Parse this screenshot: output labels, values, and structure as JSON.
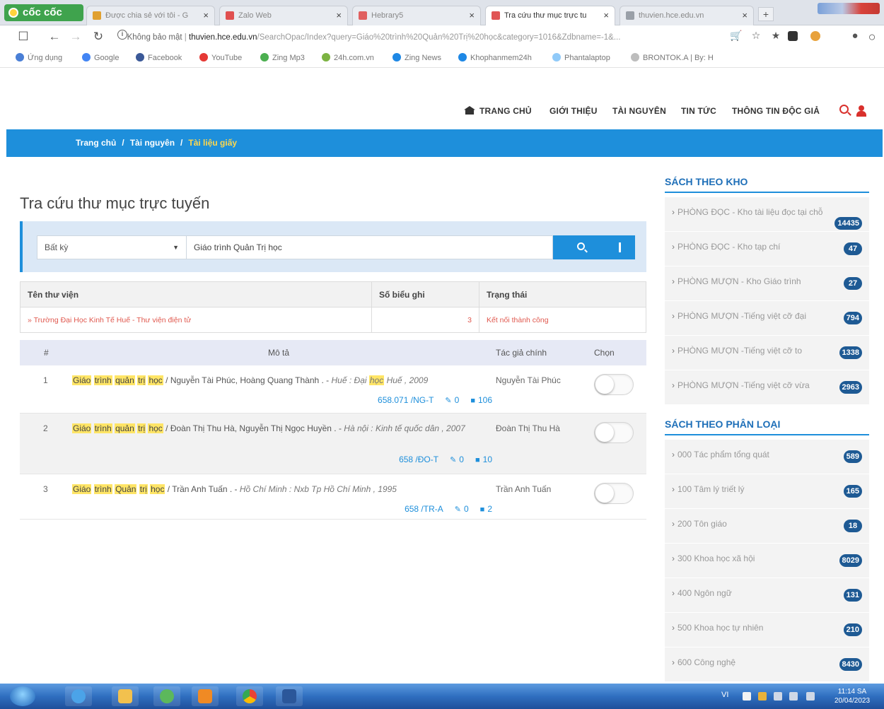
{
  "browser": {
    "brand": "cốc cốc",
    "tabs": [
      {
        "title": "Được chia sẻ với tôi - G",
        "color": "#e0a030"
      },
      {
        "title": "Zalo Web",
        "color": "#e05050"
      },
      {
        "title": "Hebrary5",
        "color": "#e06060"
      },
      {
        "title": "Tra cứu thư mục trực tu",
        "color": "#e05555"
      },
      {
        "title": "thuvien.hce.edu.vn",
        "color": "#9aa0a8"
      }
    ],
    "new_tab": "+",
    "address": {
      "not_secure": "Không bảo mật",
      "host": "thuvien.hce.edu.vn",
      "path": "/SearchOpac/Index?query=Giáo%20trình%20Quản%20Trị%20học&category=1016&Zdbname=-1&..."
    },
    "bookmarks": [
      {
        "label": "Ứng dụng",
        "color": "#4a7fd6"
      },
      {
        "label": "Google",
        "color": "#4285f4"
      },
      {
        "label": "Facebook",
        "color": "#3b5998"
      },
      {
        "label": "YouTube",
        "color": "#e53935"
      },
      {
        "label": "Zing Mp3",
        "color": "#4caf50"
      },
      {
        "label": "24h.com.vn",
        "color": "#7cb342"
      },
      {
        "label": "Zing News",
        "color": "#1e88e5"
      },
      {
        "label": "Khophanmem24h",
        "color": "#1e88e5"
      },
      {
        "label": "Phantalaptop",
        "color": "#90caf9"
      },
      {
        "label": "BRONTOK.A | By: H",
        "color": "#bdbdbd"
      }
    ]
  },
  "site": {
    "nav": [
      "TRANG CHỦ",
      "GIỚI THIỆU",
      "TÀI NGUYÊN",
      "TIN TỨC",
      "THÔNG TIN ĐỘC GIẢ"
    ],
    "breadcrumb": [
      "Trang chủ",
      "Tài nguyên",
      "Tài liệu giấy"
    ]
  },
  "main": {
    "title": "Tra cứu thư mục trực tuyến",
    "search": {
      "field": "Bất kỳ",
      "query": "Giáo trình Quản Trị học"
    },
    "library_table": {
      "headers": [
        "Tên thư viện",
        "Số biểu ghi",
        "Trạng thái"
      ],
      "rows": [
        {
          "name": "» Trường Đại Học Kinh Tế Huế - Thư viện điện tử",
          "count": "3",
          "status": "Kết nối thành công"
        }
      ]
    },
    "results": {
      "headers": [
        "#",
        "Mô tả",
        "Tác giả chính",
        "Chọn"
      ],
      "rows": [
        {
          "idx": "1",
          "title_words": [
            "Giáo",
            "trình",
            "quản",
            "trị",
            "học"
          ],
          "rest": " / Nguyễn Tài Phúc, Hoàng Quang Thành . - ",
          "pub_a": "Huế : Đại ",
          "pub_hl": "học",
          "pub_b": " Huế , 2009",
          "call": "658.071 /NG-T",
          "links": "0",
          "copies": "106",
          "author": "Nguyễn Tài Phúc"
        },
        {
          "idx": "2",
          "title_words": [
            "Giáo",
            "trình",
            "quản",
            "trị",
            "học"
          ],
          "rest": " / Đoàn Thị Thu Hà, Nguyễn Thị Ngọc Huyền . - ",
          "pub_a": "Hà nội : Kinh tế quốc dân , 2007",
          "pub_hl": "",
          "pub_b": "",
          "call": "658 /ĐO-T",
          "links": "0",
          "copies": "10",
          "author": "Đoàn Thị Thu Hà"
        },
        {
          "idx": "3",
          "title_words": [
            "Giáo",
            "trình",
            "Quản",
            "trị",
            "học"
          ],
          "rest": " / Trần Anh Tuấn . - ",
          "pub_a": "Hồ Chí Minh : Nxb Tp Hồ Chí Minh , 1995",
          "pub_hl": "",
          "pub_b": "",
          "call": "658 /TR-A",
          "links": "0",
          "copies": "2",
          "author": "Trần Anh Tuấn"
        }
      ]
    }
  },
  "sidebar": {
    "storage_title": "SÁCH THEO KHO",
    "storage": [
      {
        "label": "PHÒNG ĐỌC - Kho tài liệu đọc tại chỗ",
        "count": "14435"
      },
      {
        "label": "PHÒNG ĐỌC - Kho tạp chí",
        "count": "47"
      },
      {
        "label": "PHÒNG MƯỢN - Kho Giáo trình",
        "count": "27"
      },
      {
        "label": "PHÒNG MƯỢN -Tiếng việt cỡ đại",
        "count": "794"
      },
      {
        "label": "PHÒNG MƯỢN -Tiếng việt cỡ to",
        "count": "1338"
      },
      {
        "label": "PHÒNG MƯỢN -Tiếng việt cỡ vừa",
        "count": "2963"
      }
    ],
    "category_title": "SÁCH THEO PHÂN LOẠI",
    "categories": [
      {
        "label": "000 Tác phẩm tổng quát",
        "count": "589"
      },
      {
        "label": "100 Tâm lý triết lý",
        "count": "165"
      },
      {
        "label": "200 Tôn giáo",
        "count": "18"
      },
      {
        "label": "300 Khoa học xã hội",
        "count": "8029"
      },
      {
        "label": "400 Ngôn ngữ",
        "count": "131"
      },
      {
        "label": "500 Khoa học tự nhiên",
        "count": "210"
      },
      {
        "label": "600 Công nghệ",
        "count": "8430"
      }
    ]
  },
  "taskbar": {
    "lang": "VI",
    "time": "11:14 SA",
    "date": "20/04/2023"
  }
}
